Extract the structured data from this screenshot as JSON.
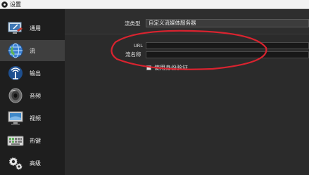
{
  "window": {
    "title": "设置"
  },
  "sidebar": {
    "items": [
      {
        "label": "通用",
        "icon": "monitor-icon"
      },
      {
        "label": "流",
        "icon": "globe-icon",
        "active": true
      },
      {
        "label": "输出",
        "icon": "antenna-icon"
      },
      {
        "label": "音频",
        "icon": "speaker-icon"
      },
      {
        "label": "视频",
        "icon": "display-icon"
      },
      {
        "label": "热键",
        "icon": "keyboard-icon"
      },
      {
        "label": "高级",
        "icon": "gears-icon"
      }
    ]
  },
  "stream": {
    "service_type_label": "流类型",
    "service_type_value": "自定义流媒体服务器",
    "url_label": "URL",
    "url_value": "",
    "stream_key_label": "流名称",
    "stream_key_value": "",
    "auth_label": "使用身份验证",
    "auth_checked": false
  },
  "colors": {
    "annotation": "#d9232f",
    "sidebar_bg": "#1e1e1e",
    "panel_bg": "#2b2b2b",
    "active_item": "#3f3f3f"
  }
}
